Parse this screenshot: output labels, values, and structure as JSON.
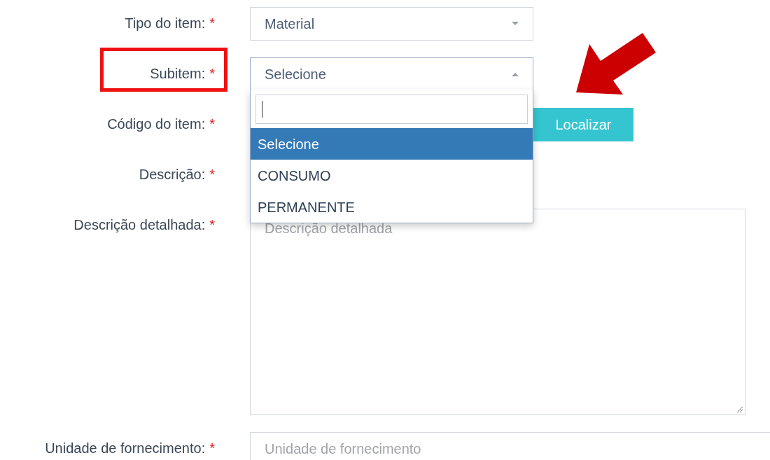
{
  "fields": [
    {
      "kind": "select",
      "label": "Tipo do item:",
      "required_mark": "*",
      "value": "Material",
      "expanded": false
    },
    {
      "kind": "select",
      "label": "Subitem:",
      "required_mark": "*",
      "value": "Selecione",
      "expanded": true,
      "annotated": true,
      "options": [
        {
          "label": "Selecione",
          "selected": true
        },
        {
          "label": "CONSUMO",
          "selected": false
        },
        {
          "label": "PERMANENTE",
          "selected": false
        }
      ]
    },
    {
      "kind": "code",
      "label": "Código do item:",
      "required_mark": "*",
      "button": "Localizar"
    },
    {
      "kind": "text",
      "label": "Descrição:",
      "required_mark": "*"
    },
    {
      "kind": "textarea",
      "label": "Descrição detalhada:",
      "required_mark": "*",
      "placeholder": "Descrição detalhada"
    },
    {
      "kind": "text",
      "label": "Unidade de fornecimento:",
      "required_mark": "*",
      "placeholder": "Unidade de fornecimento"
    }
  ]
}
